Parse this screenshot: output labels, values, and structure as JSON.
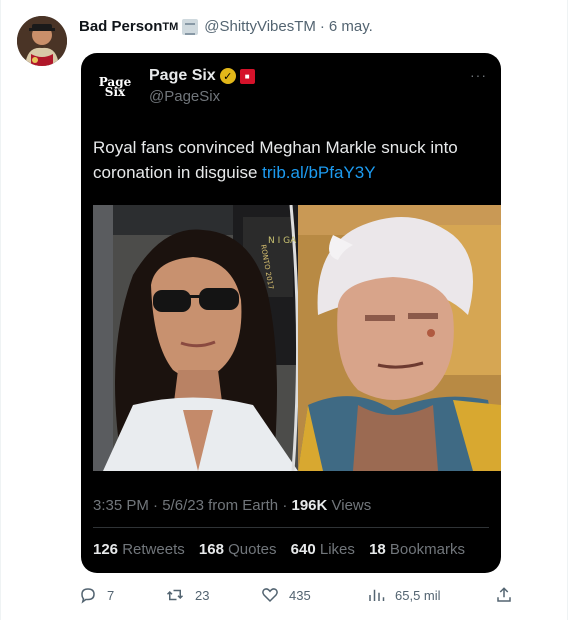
{
  "tweet": {
    "display_name": "Bad Person",
    "name_suffix": "TM",
    "handle": "@ShittyVibesTM",
    "date": "6 may.",
    "separator": "·"
  },
  "quoted": {
    "avatar_text_1": "Page",
    "avatar_text_2": "Six",
    "name": "Page Six",
    "handle": "@PageSix",
    "text": "Royal fans convinced Meghan Markle snuck into coronation in disguise ",
    "link": "trib.al/bPfaY3Y",
    "time": "3:35 PM",
    "date": "5/6/23",
    "source": "from Earth",
    "views_count": "196K",
    "views_label": "Views",
    "retweets_count": "126",
    "retweets_label": "Retweets",
    "quotes_count": "168",
    "quotes_label": "Quotes",
    "likes_count": "640",
    "likes_label": "Likes",
    "bookmarks_count": "18",
    "bookmarks_label": "Bookmarks",
    "media_text": "RONTO 2017",
    "media_sign": "N I\nGA"
  },
  "actions": {
    "replies": "7",
    "retweets": "23",
    "likes": "435",
    "views": "65,5 mil"
  },
  "colors": {
    "link": "#1d9bf0",
    "muted": "#536471",
    "card_bg": "#000000",
    "gold_badge": "#e2b719",
    "red_badge": "#d5122a"
  }
}
